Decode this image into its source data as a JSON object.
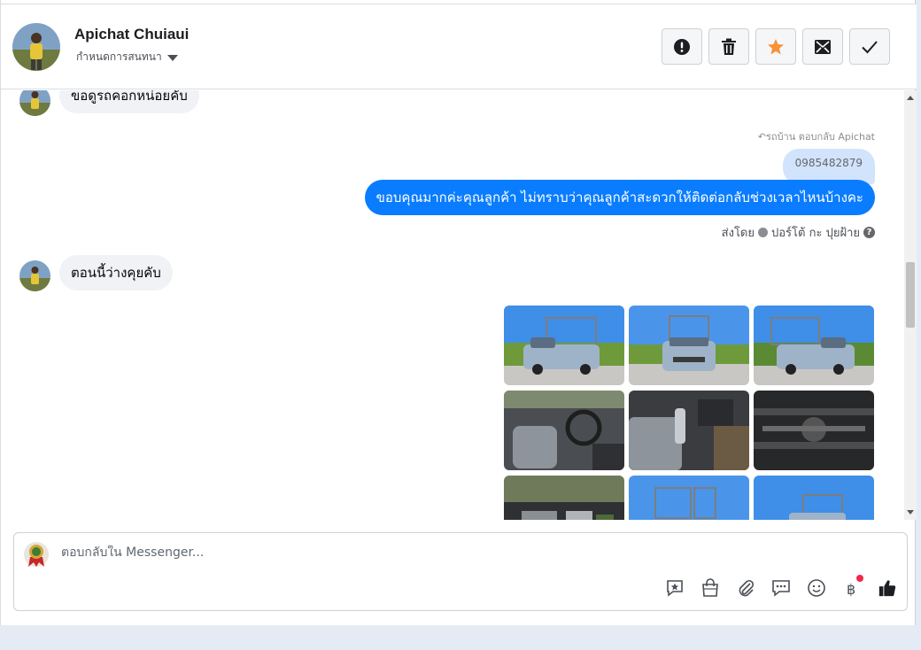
{
  "header": {
    "contact_name": "Apichat Chuiaui",
    "assign_label": "กำหนดการสนทนา",
    "actions": [
      {
        "name": "mark-spam-button",
        "icon": "exclamation-icon"
      },
      {
        "name": "delete-button",
        "icon": "trash-icon"
      },
      {
        "name": "star-button",
        "icon": "star-icon"
      },
      {
        "name": "move-to-inbox-button",
        "icon": "inbox-icon"
      },
      {
        "name": "mark-done-button",
        "icon": "check-icon"
      }
    ]
  },
  "thread": {
    "msg1": "ขอดูรถคอกหน่อยคับ",
    "reply_meta": "รถบ้าน ตอบกลับ Apichat",
    "quoted_text": "0985482879",
    "msg_out": "ขอบคุณมากค่ะคุณลูกค้า ไม่ทราบว่าคุณลูกค้าสะดวกให้ติดต่อกลับช่วงเวลาไหนบ้างคะ",
    "sent_by_label": "ส่งโดย",
    "sent_by_name": "ปอร์โต้ กะ ปุยฝ้าย",
    "msg2": "ตอนนี้ว่างคุยคับ",
    "photos": [
      {
        "kind": "truck-front-left"
      },
      {
        "kind": "truck-front"
      },
      {
        "kind": "truck-front-right"
      },
      {
        "kind": "interior-dash"
      },
      {
        "kind": "interior-gear"
      },
      {
        "kind": "undercarriage"
      },
      {
        "kind": "engine-bay"
      },
      {
        "kind": "truck-rear"
      },
      {
        "kind": "truck-side"
      }
    ]
  },
  "composer": {
    "placeholder": "ตอบกลับใน Messenger...",
    "tools": [
      "saved-reply-icon",
      "shop-bag-icon",
      "attachment-icon",
      "chat-bubble-icon",
      "emoji-icon",
      "baht-payment-icon",
      "like-icon"
    ]
  },
  "colors": {
    "accent": "#0a7cff",
    "quoted_bg": "#d2e3fc",
    "incoming_bg": "#f0f2f5",
    "star": "#f7923b",
    "notification": "#f02849"
  }
}
